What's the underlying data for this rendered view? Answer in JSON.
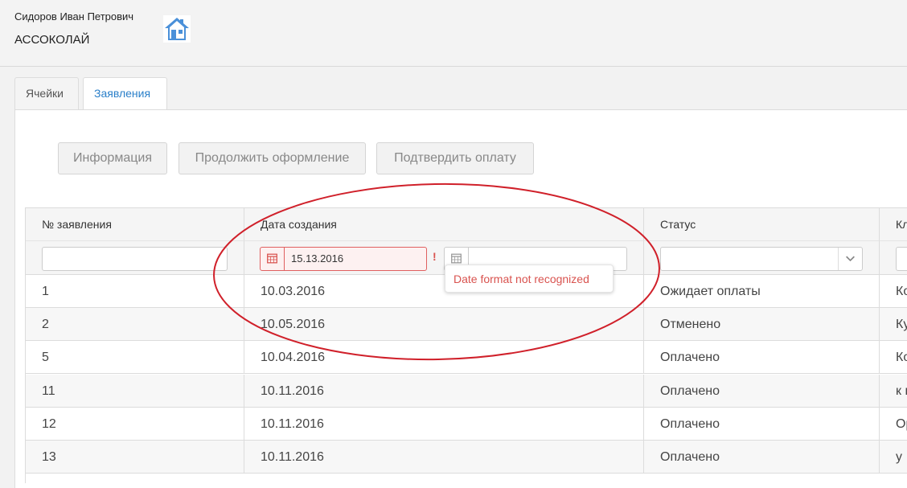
{
  "header": {
    "user_name": "Сидоров Иван Петрович",
    "org_name": "АССОКОЛАЙ",
    "home_icon": "home-icon",
    "home_icon_color": "#4a90d9"
  },
  "tabs": [
    {
      "label": "Ячейки",
      "active": false
    },
    {
      "label": "Заявления",
      "active": true
    }
  ],
  "toolbar": {
    "info_label": "Информация",
    "continue_label": "Продолжить оформление",
    "confirm_label": "Подтвердить оплату"
  },
  "table": {
    "columns": [
      "№ заявления",
      "Дата создания",
      "Статус",
      "Кл"
    ],
    "filters": {
      "number": "",
      "date_from": "15.13.2016",
      "date_to": "",
      "status": "",
      "client": ""
    },
    "error_mark": "!",
    "error_tooltip": "Date format not recognized",
    "rows": [
      {
        "number": "1",
        "date": "10.03.2016",
        "status": "Ожидает оплаты",
        "client": "Ко"
      },
      {
        "number": "2",
        "date": "10.05.2016",
        "status": "Отменено",
        "client": "Ку"
      },
      {
        "number": "5",
        "date": "10.04.2016",
        "status": "Оплачено",
        "client": "Ко"
      },
      {
        "number": "11",
        "date": "10.11.2016",
        "status": "Оплачено",
        "client": "к н"
      },
      {
        "number": "12",
        "date": "10.11.2016",
        "status": "Оплачено",
        "client": "Ор"
      },
      {
        "number": "13",
        "date": "10.11.2016",
        "status": "Оплачено",
        "client": "у"
      }
    ]
  },
  "colors": {
    "accent": "#2a7fc9",
    "error": "#d9534f",
    "annotation": "#d0202a"
  }
}
